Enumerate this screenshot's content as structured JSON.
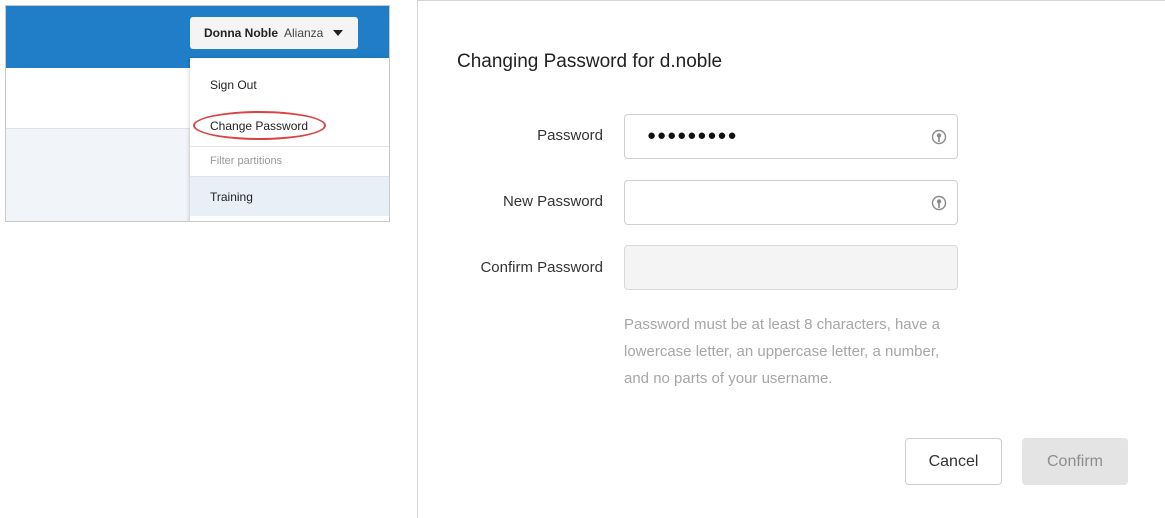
{
  "header": {
    "user_name": "Donna Noble",
    "org_name": "Alianza",
    "brand_color": "#1f7ec7"
  },
  "account_menu": {
    "sign_out": "Sign Out",
    "change_password": "Change Password",
    "filter_placeholder": "Filter partitions",
    "partitions": [
      "Training"
    ],
    "highlight_color": "#d94343"
  },
  "dialog": {
    "title": "Changing Password for d.noble",
    "fields": {
      "password": {
        "label": "Password",
        "value": "●●●●●●●●●"
      },
      "new_password": {
        "label": "New Password",
        "value": ""
      },
      "confirm_password": {
        "label": "Confirm Password",
        "value": ""
      }
    },
    "hint": "Password must be at least 8 characters, have a lowercase letter, an uppercase letter, a number, and no parts of your username.",
    "buttons": {
      "cancel": "Cancel",
      "confirm": "Confirm"
    }
  }
}
